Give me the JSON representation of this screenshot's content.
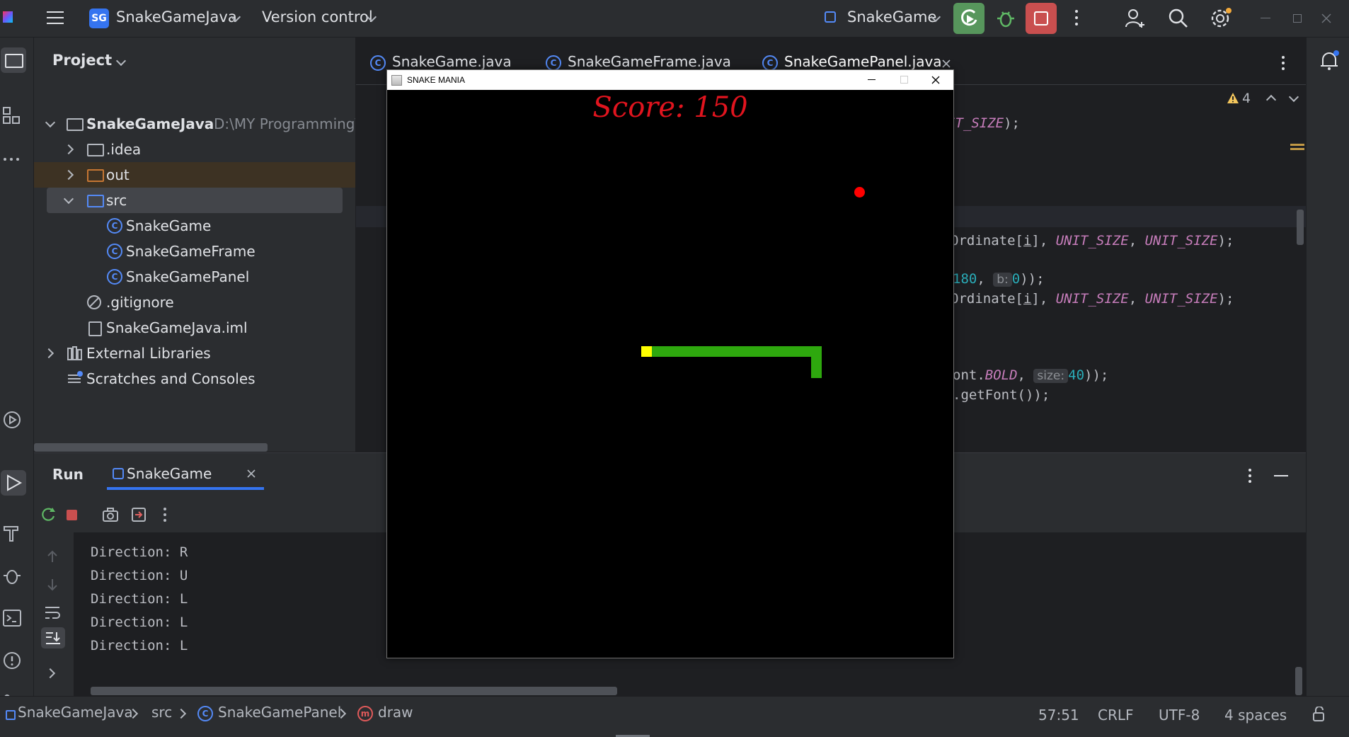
{
  "titlebar": {
    "project_badge": "SG",
    "project_name": "SnakeGameJava",
    "vcs_label": "Version control",
    "run_config": "SnakeGame"
  },
  "project_panel": {
    "title": "Project",
    "root_name": "SnakeGameJava",
    "root_path": "D:\\MY Programming\\S",
    "items": [
      {
        "label": ".idea"
      },
      {
        "label": "out"
      },
      {
        "label": "src"
      },
      {
        "label": "SnakeGame"
      },
      {
        "label": "SnakeGameFrame"
      },
      {
        "label": "SnakeGamePanel"
      },
      {
        "label": ".gitignore"
      },
      {
        "label": "SnakeGameJava.iml"
      },
      {
        "label": "External Libraries"
      },
      {
        "label": "Scratches and Consoles"
      }
    ]
  },
  "editor": {
    "tabs": [
      {
        "label": "SnakeGame.java"
      },
      {
        "label": "SnakeGameFrame.java"
      },
      {
        "label": "SnakeGamePanel.java"
      }
    ],
    "warnings_count": "4",
    "lines": {
      "l1_a": "IT_SIZE",
      "l1_b": ");",
      "l2_a": "Ordinate[",
      "l2_b": "i",
      "l2_c": "], ",
      "l2_d": "UNIT_SIZE",
      "l2_e": ", ",
      "l2_f": "UNIT_SIZE",
      "l2_g": ");",
      "l3_a": "180",
      "l3_b": ", ",
      "l3_hint": "b:",
      "l3_c": "0",
      "l3_d": "));",
      "l5_a": "ont.",
      "l5_b": "BOLD",
      "l5_c": ", ",
      "l5_hint": "size:",
      "l5_d": "40",
      "l5_e": "));",
      "l6_a": ".getFont());"
    }
  },
  "run_panel": {
    "title": "Run",
    "tab_label": "SnakeGame",
    "console": [
      "Direction: R",
      "Direction: U",
      "Direction: L",
      "Direction: L",
      "Direction: L"
    ]
  },
  "game_window": {
    "title": "SNAKE MANIA",
    "score": "Score: 150",
    "colors": {
      "food": "#ff0000",
      "head": "#ffff00",
      "body": "#2ea80e",
      "background": "#000000"
    }
  },
  "statusbar": {
    "crumbs": [
      "SnakeGameJava",
      "src",
      "SnakeGamePanel",
      "draw"
    ],
    "position": "57:51",
    "line_ending": "CRLF",
    "encoding": "UTF-8",
    "indent": "4 spaces"
  }
}
